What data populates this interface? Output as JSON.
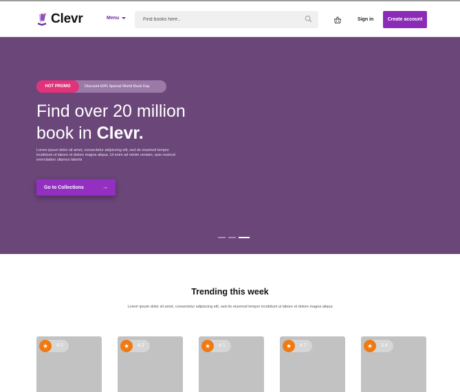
{
  "header": {
    "brand": "Clevr",
    "menu_label": "Menu",
    "search_placeholder": "Find books here..",
    "signin_label": "Sign in",
    "create_account_label": "Create account"
  },
  "hero": {
    "promo_tag": "HOT PROMO",
    "promo_text": "Discount 60% Special World Book Day",
    "title_line1": "Find over 20 million",
    "title_line2_prefix": "book in ",
    "title_line2_brand": "Clevr.",
    "description": "Lorem ipsum dolor sit amet, consectetur adipiscing elit, sed do eiusmod tempor incididunt ut labore et dolore magna aliqua. Ut enim ad minim veniam, quis nostrud exercitation ullamco laboris",
    "cta_label": "Go to Collections",
    "slides": {
      "count": 3,
      "active_index": 2
    }
  },
  "trending": {
    "title": "Trending this week",
    "description": "Lorem ipsum dolor sit amet, consectetur adipiscing elit, sed do eiusmod tempor incididunt ut labore et dolore magna aliqua",
    "books": [
      {
        "rating": "4.5"
      },
      {
        "rating": "4.2"
      },
      {
        "rating": "4.1"
      },
      {
        "rating": "4.7"
      },
      {
        "rating": "3.4"
      }
    ]
  },
  "colors": {
    "brand_purple": "#8a2cb8",
    "hero_background": "#6b4679",
    "promo_pink": "#e0337a",
    "rating_orange": "#f07a12"
  },
  "icons": [
    "book-logo-icon",
    "chevron-down-icon",
    "search-icon",
    "basket-icon",
    "arrow-right-icon",
    "star-icon"
  ]
}
